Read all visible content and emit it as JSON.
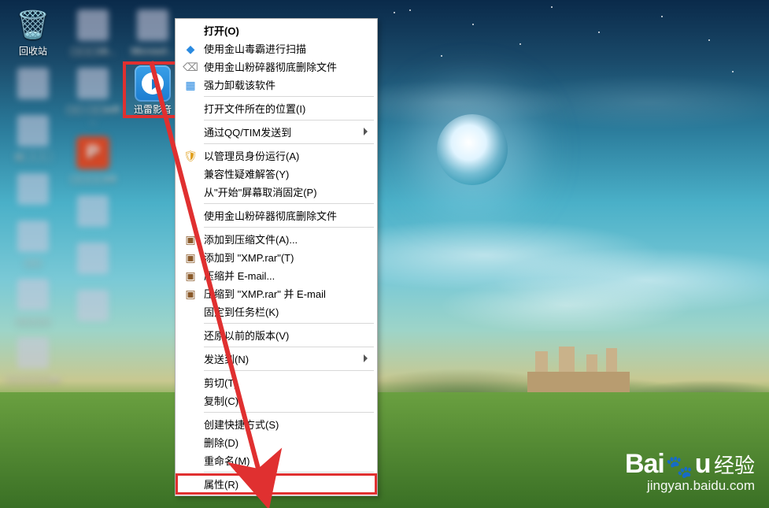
{
  "desktop": {
    "cols": [
      [
        {
          "name": "recycle-bin",
          "label": "回收站",
          "iconName": "recycle-bin-icon",
          "glyph": "🗑️",
          "interactable": true,
          "blur": false
        },
        {
          "name": "blur-1",
          "label": "",
          "iconName": "generic-icon",
          "glyph": "▦",
          "interactable": true,
          "blur": true
        },
        {
          "name": "blur-2",
          "label": "公▢▢▢",
          "iconName": "generic-icon",
          "glyph": "▦",
          "interactable": true,
          "blur": true
        },
        {
          "name": "blur-3",
          "label": "",
          "iconName": "generic-icon",
          "glyph": "▦",
          "interactable": true,
          "blur": true
        },
        {
          "name": "blur-4",
          "label": "▢▢",
          "iconName": "generic-icon",
          "glyph": "▦",
          "interactable": true,
          "blur": true
        },
        {
          "name": "blur-5",
          "label": "▢▢▢▢",
          "iconName": "generic-icon",
          "glyph": "▦",
          "interactable": true,
          "blur": true
        },
        {
          "name": "blur-6",
          "label": "▢▢▢▢▢ao",
          "iconName": "generic-icon",
          "glyph": "▦",
          "interactable": true,
          "blur": true
        }
      ],
      [
        {
          "name": "blur-7",
          "label": "▢▢▢18...",
          "iconName": "generic-icon",
          "glyph": "▦",
          "interactable": true,
          "blur": true
        },
        {
          "name": "blur-8",
          "label": "▢▢\n▢▢soft ...",
          "iconName": "generic-icon",
          "glyph": "▦",
          "interactable": true,
          "blur": true
        },
        {
          "name": "powerpoint",
          "label": "▢▢▢▢n3",
          "iconName": "powerpoint-icon",
          "glyph": "P",
          "interactable": true,
          "blur": true
        },
        {
          "name": "blur-9",
          "label": "",
          "iconName": "generic-icon",
          "glyph": "▦",
          "interactable": true,
          "blur": true
        },
        {
          "name": "blur-10",
          "label": "",
          "iconName": "generic-icon",
          "glyph": "▦",
          "interactable": true,
          "blur": true
        },
        {
          "name": "blur-11",
          "label": "",
          "iconName": "generic-icon",
          "glyph": "▦",
          "interactable": true,
          "blur": true
        }
      ],
      [
        {
          "name": "microsoft",
          "label": "Microsof...",
          "iconName": "generic-icon",
          "glyph": "▦",
          "interactable": true,
          "blur": true
        },
        {
          "name": "xunlei-player",
          "label": "迅雷影音",
          "iconName": "xunlei-player-icon",
          "glyph": "XMP",
          "interactable": true,
          "blur": false,
          "selected": true
        }
      ]
    ]
  },
  "context_menu": {
    "items": [
      {
        "id": "open",
        "label": "打开(O)",
        "bold": true
      },
      {
        "id": "scan-jinshan",
        "label": "使用金山毒霸进行扫描",
        "iconName": "shield-scan-icon",
        "iconColor": "#2a8ae0",
        "glyph": "◆"
      },
      {
        "id": "shred-jinshan",
        "label": "使用金山粉碎器彻底删除文件",
        "iconName": "shredder-icon",
        "iconColor": "#888",
        "glyph": "⌫"
      },
      {
        "id": "force-uninstall",
        "label": "强力卸载该软件",
        "iconName": "uninstall-icon",
        "iconColor": "#2a8ae0",
        "glyph": "▦"
      },
      {
        "sep": true
      },
      {
        "id": "open-location",
        "label": "打开文件所在的位置(I)"
      },
      {
        "sep": true
      },
      {
        "id": "send-qq-tim",
        "label": "通过QQ/TIM发送到",
        "arrow": true
      },
      {
        "sep": true
      },
      {
        "id": "run-as-admin",
        "label": "以管理员身份运行(A)",
        "iconName": "admin-shield-icon",
        "iconColor": "#e0a020",
        "glyph": "🛡"
      },
      {
        "id": "compat-troubleshoot",
        "label": "兼容性疑难解答(Y)"
      },
      {
        "id": "unpin-start",
        "label": "从\"开始\"屏幕取消固定(P)"
      },
      {
        "sep": true
      },
      {
        "id": "shred-jinshan-2",
        "label": "使用金山粉碎器彻底删除文件"
      },
      {
        "sep": true
      },
      {
        "id": "add-to-archive",
        "label": "添加到压缩文件(A)...",
        "iconName": "archive-icon",
        "iconColor": "#8a5a2a",
        "glyph": "▣"
      },
      {
        "id": "add-to-xmp-rar",
        "label": "添加到 \"XMP.rar\"(T)",
        "iconName": "archive-icon",
        "iconColor": "#8a5a2a",
        "glyph": "▣"
      },
      {
        "id": "compress-email",
        "label": "压缩并 E-mail...",
        "iconName": "archive-icon",
        "iconColor": "#8a5a2a",
        "glyph": "▣"
      },
      {
        "id": "compress-xmp-email",
        "label": "压缩到 \"XMP.rar\" 并 E-mail",
        "iconName": "archive-icon",
        "iconColor": "#8a5a2a",
        "glyph": "▣"
      },
      {
        "id": "pin-taskbar",
        "label": "固定到任务栏(K)"
      },
      {
        "sep": true
      },
      {
        "id": "restore-previous",
        "label": "还原以前的版本(V)"
      },
      {
        "sep": true
      },
      {
        "id": "send-to",
        "label": "发送到(N)",
        "arrow": true
      },
      {
        "sep": true
      },
      {
        "id": "cut",
        "label": "剪切(T)"
      },
      {
        "id": "copy",
        "label": "复制(C)"
      },
      {
        "sep": true
      },
      {
        "id": "create-shortcut",
        "label": "创建快捷方式(S)"
      },
      {
        "id": "delete",
        "label": "删除(D)"
      },
      {
        "id": "rename",
        "label": "重命名(M)"
      },
      {
        "sep": true
      },
      {
        "id": "properties",
        "label": "属性(R)",
        "highlight": true
      }
    ]
  },
  "watermark": {
    "brand_prefix": "Bai",
    "brand_suffix": "u",
    "suffix": "经验",
    "url": "jingyan.baidu.com"
  }
}
